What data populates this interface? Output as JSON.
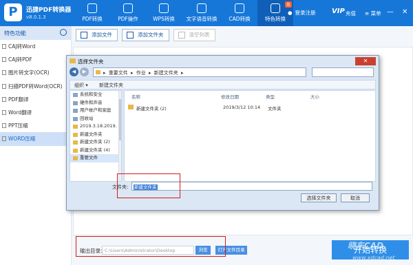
{
  "app": {
    "name": "迅捷PDF转换器",
    "version": "v8.0.1.3",
    "logo_letter": "P"
  },
  "nav": [
    {
      "label": "PDF转换",
      "active": false
    },
    {
      "label": "PDF操作",
      "active": false
    },
    {
      "label": "WPS转换",
      "active": false
    },
    {
      "label": "文字语音转换",
      "active": false
    },
    {
      "label": "CAD转换",
      "active": false
    },
    {
      "label": "特色转换",
      "active": true,
      "badge": "热"
    }
  ],
  "user": {
    "login": "登录注册",
    "vip": "VIP",
    "charge": "充值",
    "menu": "菜单"
  },
  "sidebar": {
    "header": "特色功能",
    "items": [
      {
        "label": "CAJ转Word"
      },
      {
        "label": "CAJ转PDF"
      },
      {
        "label": "图片转文字(OCR)"
      },
      {
        "label": "扫描PDF转Word(OCR)"
      },
      {
        "label": "PDF翻译"
      },
      {
        "label": "Word翻译"
      },
      {
        "label": "PPT压缩"
      },
      {
        "label": "WORD压缩",
        "active": true
      }
    ]
  },
  "toolbar": {
    "add_file": "添加文件",
    "add_folder": "添加文件夹",
    "clear_list": "清空列表"
  },
  "dialog": {
    "title": "选择文件夹",
    "close": "✕",
    "breadcrumb": [
      "重要文件",
      "作业",
      "新建文件夹"
    ],
    "commands": [
      "组织 ▾",
      "新建文件夹"
    ],
    "columns": {
      "name": "名称",
      "date": "修改日期",
      "type": "类型",
      "size": "大小"
    },
    "tree": [
      {
        "label": "系统和安全",
        "kind": "sys"
      },
      {
        "label": "硬件和声音",
        "kind": "sys"
      },
      {
        "label": "用户帐户和家庭",
        "kind": "sys"
      },
      {
        "label": "回收站",
        "kind": "sys"
      },
      {
        "label": "2019.3.18.2019.",
        "kind": "folder"
      },
      {
        "label": "新建文件夹",
        "kind": "folder"
      },
      {
        "label": "新建文件夹 (2)",
        "kind": "folder"
      },
      {
        "label": "新建文件夹 (4)",
        "kind": "folder"
      },
      {
        "label": "重要文件",
        "kind": "folder",
        "selected": true
      }
    ],
    "files": [
      {
        "name": "新建文件夹 (2)",
        "date": "2019/3/12 10:14",
        "type": "文件夹"
      }
    ],
    "folder_label": "文件夹:",
    "folder_value": "新建文件夹",
    "select_button": "选择文件夹",
    "cancel_button": "取消"
  },
  "bottom": {
    "output_label": "输出目录：",
    "output_path": "C:\\Users\\Administrator\\Desktop",
    "browse": "浏览",
    "open_dir": "打开文件目录",
    "start": "开始转换"
  },
  "watermark": {
    "main": "晓东CAD",
    "sub": "www.xdcad.net"
  },
  "colors": {
    "accent": "#1677d9",
    "highlight_box": "#d21a1a"
  }
}
